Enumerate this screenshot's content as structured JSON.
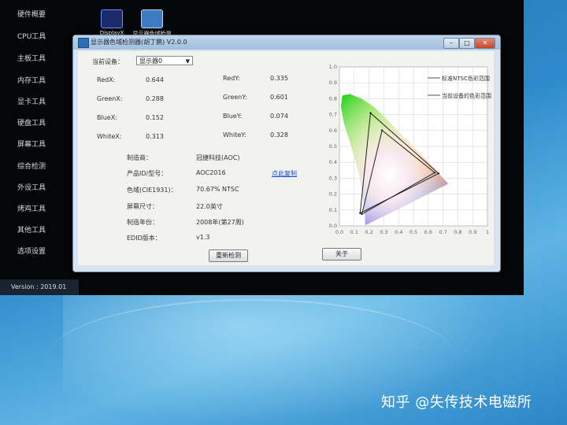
{
  "sidebar": {
    "items": [
      "硬件概要",
      "CPU工具",
      "主板工具",
      "内存工具",
      "显卡工具",
      "硬盘工具",
      "屏幕工具",
      "综合检测",
      "外设工具",
      "烤鸡工具",
      "其他工具",
      "选项设置"
    ],
    "version": "Version : 2019.01"
  },
  "desktop_icons": [
    {
      "label": "DisplayX",
      "icon": "displayx-icon"
    },
    {
      "label": "显示器色域检测",
      "icon": "monitor-icon"
    }
  ],
  "window": {
    "title": "显示器色域检测器(胡丁鹏) V2.0.0",
    "device_label": "当前设备：",
    "device_value": "显示器0",
    "fields": [
      {
        "label": "RedX:",
        "value": "0.644"
      },
      {
        "label": "RedY:",
        "value": "0.335"
      },
      {
        "label": "GreenX:",
        "value": "0.288"
      },
      {
        "label": "GreenY:",
        "value": "0.601"
      },
      {
        "label": "BlueX:",
        "value": "0.152"
      },
      {
        "label": "BlueY:",
        "value": "0.074"
      },
      {
        "label": "WhiteX:",
        "value": "0.313"
      },
      {
        "label": "WhiteY:",
        "value": "0.328"
      }
    ],
    "info": [
      {
        "label": "制造商：",
        "value": "冠捷科技(AOC)"
      },
      {
        "label": "产品ID/型号：",
        "value": "AOC2016"
      },
      {
        "label": "色域(CIE1931)：",
        "value": "70.67% NTSC"
      },
      {
        "label": "屏幕尺寸：",
        "value": "22.0英寸"
      },
      {
        "label": "制造年份：",
        "value": "2008年(第27周)"
      },
      {
        "label": "EDID版本：",
        "value": "v1.3"
      }
    ],
    "copy_link": "点此复制",
    "redetect_button": "重新检测",
    "about_button": "关于"
  },
  "chart_data": {
    "type": "scatter",
    "title": "",
    "xlabel": "",
    "ylabel": "",
    "xlim": [
      0,
      1
    ],
    "ylim": [
      0,
      1
    ],
    "x_ticks": [
      "0.0",
      "0.1",
      "0.2",
      "0.3",
      "0.4",
      "0.5",
      "0.6",
      "0.7",
      "0.8",
      "0.9",
      "1"
    ],
    "y_ticks": [
      "0.0",
      "0.1",
      "0.2",
      "0.3",
      "0.4",
      "0.5",
      "0.6",
      "0.7",
      "0.8",
      "0.9",
      "1.0"
    ],
    "grid": true,
    "legend_position": "top-right",
    "series": [
      {
        "name": "标准NTSC色彩范围",
        "points": [
          [
            0.67,
            0.33
          ],
          [
            0.21,
            0.71
          ],
          [
            0.14,
            0.08
          ]
        ],
        "color": "#222222"
      },
      {
        "name": "当前设备的色彩范围",
        "points": [
          [
            0.644,
            0.335
          ],
          [
            0.288,
            0.601
          ],
          [
            0.152,
            0.074
          ]
        ],
        "color": "#222222"
      }
    ],
    "spectral_locus": [
      [
        0.175,
        0.005
      ],
      [
        0.174,
        0.05
      ],
      [
        0.165,
        0.15
      ],
      [
        0.14,
        0.3
      ],
      [
        0.08,
        0.5
      ],
      [
        0.03,
        0.65
      ],
      [
        0.01,
        0.75
      ],
      [
        0.02,
        0.82
      ],
      [
        0.07,
        0.83
      ],
      [
        0.15,
        0.8
      ],
      [
        0.23,
        0.75
      ],
      [
        0.3,
        0.69
      ],
      [
        0.4,
        0.59
      ],
      [
        0.5,
        0.5
      ],
      [
        0.6,
        0.4
      ],
      [
        0.735,
        0.265
      ]
    ]
  },
  "watermark": "知乎 @失传技术电磁所"
}
